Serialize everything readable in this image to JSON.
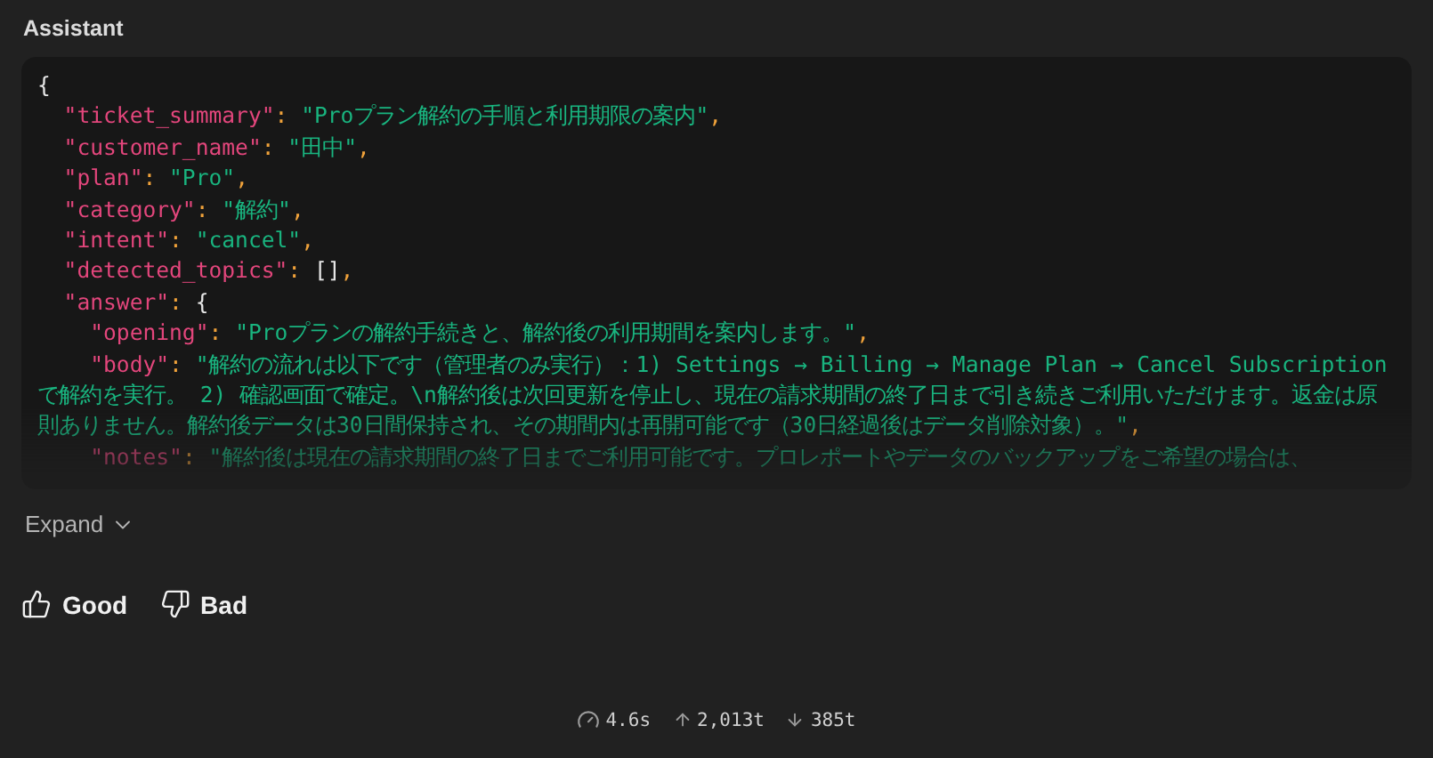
{
  "header": {
    "title": "Assistant"
  },
  "code": {
    "open": "{",
    "entries": [
      {
        "key": "\"ticket_summary\"",
        "sep": ":",
        "value": "\"Proプラン解約の手順と利用期限の案内\"",
        "kind": "string",
        "end": ","
      },
      {
        "key": "\"customer_name\"",
        "sep": ":",
        "value": "\"田中\"",
        "kind": "string",
        "end": ","
      },
      {
        "key": "\"plan\"",
        "sep": ":",
        "value": "\"Pro\"",
        "kind": "string",
        "end": ","
      },
      {
        "key": "\"category\"",
        "sep": ":",
        "value": "\"解約\"",
        "kind": "string",
        "end": ","
      },
      {
        "key": "\"intent\"",
        "sep": ":",
        "value": "\"cancel\"",
        "kind": "string",
        "end": ","
      },
      {
        "key": "\"detected_topics\"",
        "sep": ":",
        "value": "[]",
        "kind": "array",
        "end": ","
      },
      {
        "key": "\"answer\"",
        "sep": ":",
        "value": "{",
        "kind": "object",
        "children": [
          {
            "key": "\"opening\"",
            "sep": ":",
            "value": "\"Proプランの解約手続きと、解約後の利用期間を案内します。\"",
            "kind": "string",
            "end": ","
          },
          {
            "key": "\"body\"",
            "sep": ":",
            "value": "\"解約の流れは以下です（管理者のみ実行）：1) Settings → Billing → Manage Plan → Cancel Subscriptionで解約を実行。 2) 確認画面で確定。\\n解約後は次回更新を停止し、現在の請求期間の終了日まで引き続きご利用いただけます。返金は原則ありません。解約後データは30日間保持され、その期間内は再開可能です（30日経過後はデータ削除対象）。\"",
            "kind": "string",
            "end": ","
          },
          {
            "key": "\"notes\"",
            "sep": ":",
            "value": "\"解約後は現在の請求期間の終了日までご利用可能です。プロレポートやデータのバックアップをご希望の場合は、",
            "kind": "string"
          }
        ]
      }
    ]
  },
  "expand": {
    "label": "Expand",
    "expanded": false
  },
  "feedback": [
    {
      "label": "Good",
      "kind": "up"
    },
    {
      "label": "Bad",
      "kind": "down"
    }
  ],
  "stats": [
    {
      "kind": "time",
      "text": "4.6s"
    },
    {
      "kind": "in",
      "text": "2,013t"
    },
    {
      "kind": "out",
      "text": "385t"
    }
  ]
}
